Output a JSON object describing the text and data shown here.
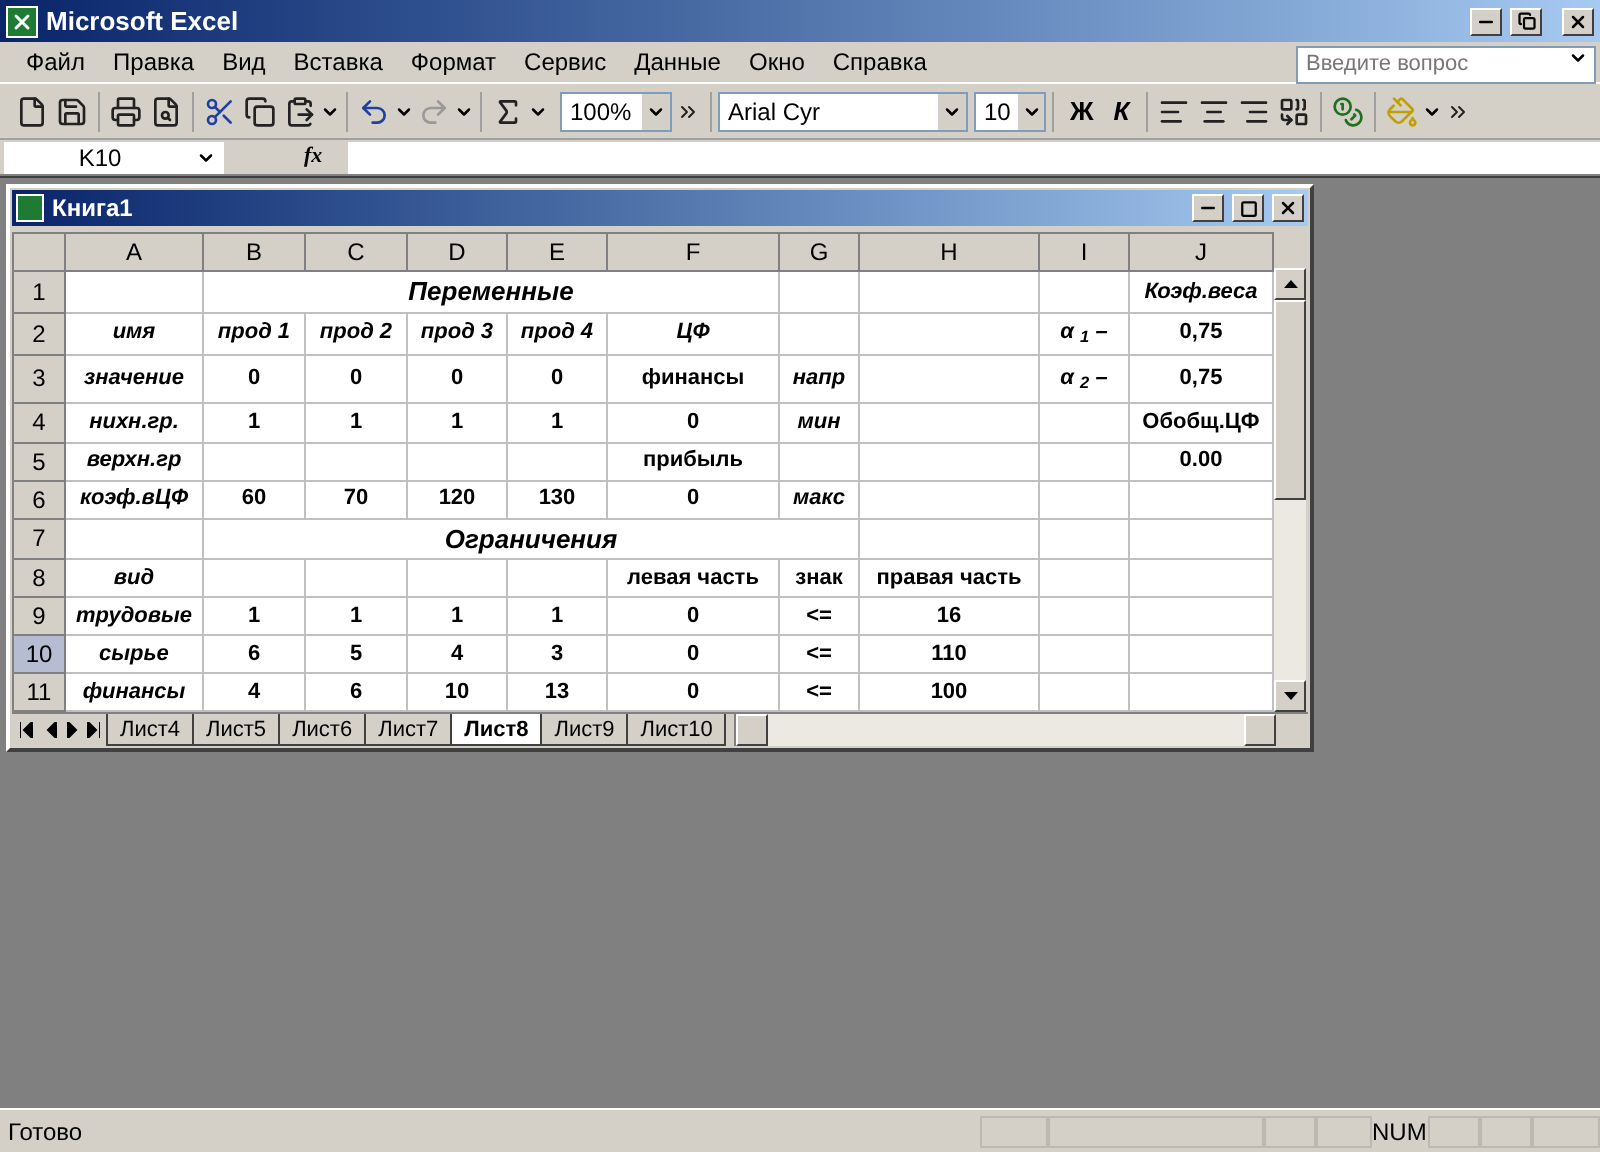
{
  "app_title": "Microsoft Excel",
  "menu": [
    "Файл",
    "Правка",
    "Вид",
    "Вставка",
    "Формат",
    "Сервис",
    "Данные",
    "Окно",
    "Справка"
  ],
  "help_search": {
    "placeholder": "Введите вопрос"
  },
  "toolbar": {
    "zoom": "100%",
    "font": "Arial Cyr",
    "font_size": "10",
    "bold_button": "Ж",
    "italic_button": "К"
  },
  "formula_bar": {
    "name_box": "K10",
    "fx": "fx"
  },
  "workbook": {
    "title": "Книга1",
    "columns": [
      {
        "label": "A",
        "selected": false
      },
      {
        "label": "B",
        "selected": false
      },
      {
        "label": "C",
        "selected": false
      },
      {
        "label": "D",
        "selected": false
      },
      {
        "label": "E",
        "selected": false
      },
      {
        "label": "F",
        "selected": false
      },
      {
        "label": "G",
        "selected": false
      },
      {
        "label": "H",
        "selected": false
      },
      {
        "label": "I",
        "selected": false
      },
      {
        "label": "J",
        "selected": false
      }
    ],
    "rows": [
      {
        "label": "1",
        "selected": false,
        "cells": [
          null,
          {
            "text": "Переменные",
            "italic": true,
            "colspan": 5
          },
          null,
          null,
          null,
          {
            "text": "Коэф.веса",
            "italic": true
          }
        ]
      },
      {
        "label": "2",
        "selected": false,
        "cells": [
          {
            "text": "имя",
            "italic": true
          },
          {
            "text": "прод 1",
            "italic": true
          },
          {
            "text": "прод 2",
            "italic": true
          },
          {
            "text": "прод 3",
            "italic": true
          },
          {
            "text": "прод 4",
            "italic": true
          },
          {
            "text": "ЦФ",
            "italic": true
          },
          null,
          null,
          {
            "text": "α $_{1}$ –",
            "italic": true
          },
          {
            "text": "0,75",
            "italic": false
          }
        ]
      },
      {
        "label": "3",
        "selected": false,
        "cells": [
          {
            "text": "значение",
            "italic": true
          },
          {
            "text": "0",
            "italic": false
          },
          {
            "text": "0",
            "italic": false
          },
          {
            "text": "0",
            "italic": false
          },
          {
            "text": "0",
            "italic": false
          },
          {
            "text": "финансы",
            "italic": false
          },
          {
            "text": "напр",
            "italic": true
          },
          null,
          {
            "text": "α $_{2}$ –",
            "italic": true
          },
          {
            "text": "0,75",
            "italic": false
          }
        ]
      },
      {
        "label": "4",
        "selected": false,
        "cells": [
          {
            "text": "нихн.гр.",
            "italic": true
          },
          {
            "text": "1",
            "italic": false
          },
          {
            "text": "1",
            "italic": false
          },
          {
            "text": "1",
            "italic": false
          },
          {
            "text": "1",
            "italic": false
          },
          {
            "text": "0",
            "italic": false
          },
          {
            "text": "мин",
            "italic": true
          },
          null,
          null,
          {
            "text": "Обобщ.ЦФ",
            "italic": false
          }
        ]
      },
      {
        "label": "5",
        "selected": false,
        "cells": [
          {
            "text": "верхн.гр",
            "italic": true
          },
          null,
          null,
          null,
          null,
          {
            "text": "прибыль",
            "italic": false
          },
          null,
          null,
          null,
          {
            "text": "0.00",
            "italic": false
          }
        ]
      },
      {
        "label": "6",
        "selected": false,
        "cells": [
          {
            "text": "коэф.вЦФ",
            "italic": true
          },
          {
            "text": "60",
            "italic": false
          },
          {
            "text": "70",
            "italic": false
          },
          {
            "text": "120",
            "italic": false
          },
          {
            "text": "130",
            "italic": false
          },
          {
            "text": "0",
            "italic": false
          },
          {
            "text": "макс",
            "italic": true
          },
          null,
          null,
          null
        ]
      },
      {
        "label": "7",
        "selected": false,
        "cells": [
          null,
          {
            "text": "Ограничения",
            "italic": true,
            "colspan": 6
          },
          null,
          null,
          null
        ]
      },
      {
        "label": "8",
        "selected": false,
        "cells": [
          {
            "text": "вид",
            "italic": true
          },
          null,
          null,
          null,
          null,
          {
            "text": "левая часть",
            "italic": false
          },
          {
            "text": "знак",
            "italic": false
          },
          {
            "text": "правая часть",
            "italic": false
          },
          null,
          null
        ]
      },
      {
        "label": "9",
        "selected": false,
        "cells": [
          {
            "text": "трудовые",
            "italic": true
          },
          {
            "text": "1",
            "italic": false
          },
          {
            "text": "1",
            "italic": false
          },
          {
            "text": "1",
            "italic": false
          },
          {
            "text": "1",
            "italic": false
          },
          {
            "text": "0",
            "italic": false
          },
          {
            "text": "<=",
            "italic": false
          },
          {
            "text": "16",
            "italic": false
          },
          null,
          null
        ]
      },
      {
        "label": "10",
        "selected": true,
        "cells": [
          {
            "text": "сырье",
            "italic": true
          },
          {
            "text": "6",
            "italic": false
          },
          {
            "text": "5",
            "italic": false
          },
          {
            "text": "4",
            "italic": false
          },
          {
            "text": "3",
            "italic": false
          },
          {
            "text": "0",
            "italic": false
          },
          {
            "text": "<=",
            "italic": false
          },
          {
            "text": "110",
            "italic": false
          },
          null,
          null
        ]
      },
      {
        "label": "11",
        "selected": false,
        "cells": [
          {
            "text": "финансы",
            "italic": true
          },
          {
            "text": "4",
            "italic": false
          },
          {
            "text": "6",
            "italic": false
          },
          {
            "text": "10",
            "italic": false
          },
          {
            "text": "13",
            "italic": false
          },
          {
            "text": "0",
            "italic": false
          },
          {
            "text": "<=",
            "italic": false
          },
          {
            "text": "100",
            "italic": false
          },
          null,
          null
        ]
      }
    ],
    "sheet_tabs": [
      {
        "label": "Лист4",
        "selected": false
      },
      {
        "label": "Лист5",
        "selected": false
      },
      {
        "label": "Лист6",
        "selected": false
      },
      {
        "label": "Лист7",
        "selected": false
      },
      {
        "label": "Лист8",
        "selected": true
      },
      {
        "label": "Лист9",
        "selected": false
      },
      {
        "label": "Лист10",
        "selected": false
      }
    ]
  },
  "status_bar": {
    "status": "Готово",
    "num": "NUM"
  }
}
